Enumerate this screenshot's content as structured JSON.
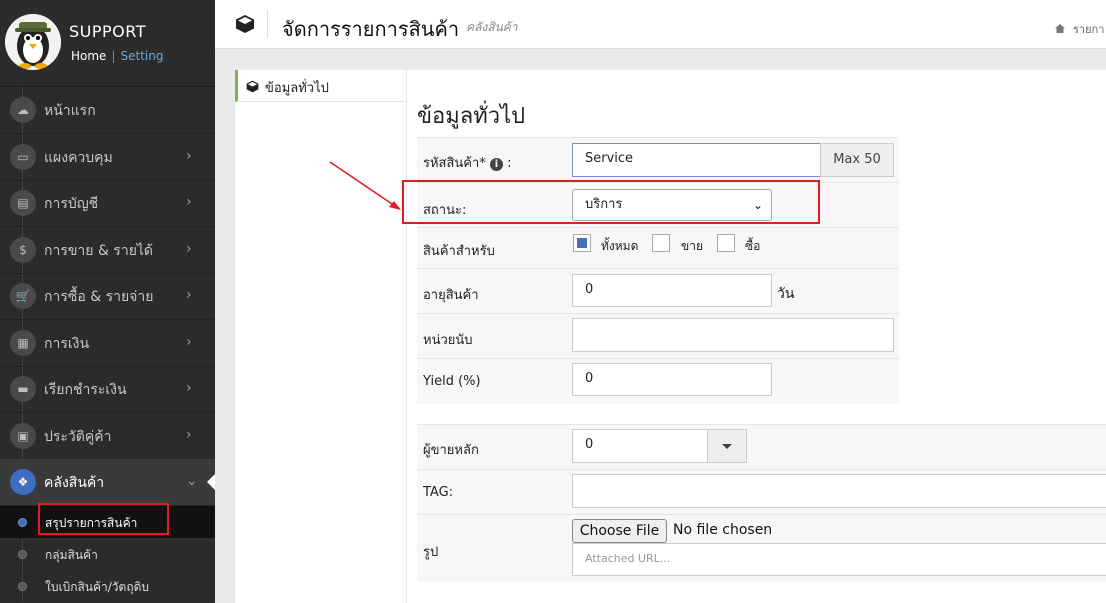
{
  "sidebar": {
    "brand": {
      "title": "SUPPORT",
      "home": "Home",
      "separator": "|",
      "setting": "Setting"
    },
    "items": [
      {
        "label": "หน้าแรก",
        "icon": "cloud-icon",
        "glyph": "☁"
      },
      {
        "label": "แผงควบคุม",
        "icon": "monitor-icon",
        "glyph": "▭"
      },
      {
        "label": "การบัญชี",
        "icon": "book-icon",
        "glyph": "▤"
      },
      {
        "label": "การขาย & รายได้",
        "icon": "dollar-icon",
        "glyph": "$"
      },
      {
        "label": "การซื้อ & รายจ่าย",
        "icon": "cart-icon",
        "glyph": "🛒"
      },
      {
        "label": "การเงิน",
        "icon": "calendar-icon",
        "glyph": "▦"
      },
      {
        "label": "เรียกชำระเงิน",
        "icon": "card-icon",
        "glyph": "▬"
      },
      {
        "label": "ประวัติคู่ค้า",
        "icon": "contact-icon",
        "glyph": "▣"
      },
      {
        "label": "คลังสินค้า",
        "icon": "cubes-icon",
        "glyph": "❖"
      }
    ],
    "chevron": "›",
    "chevron_down": "⌄",
    "subitems": [
      {
        "label": "สรุปรายการสินค้า"
      },
      {
        "label": "กลุ่มสินค้า"
      },
      {
        "label": "ใบเบิกสินค้า/วัตถุดิบ"
      }
    ]
  },
  "header": {
    "title": "จัดการรายการสินค้า",
    "subtitle": "คลังสินค้า",
    "breadcrumb": "รายกา"
  },
  "tabs": {
    "general": "ข้อมูลทั่วไป"
  },
  "form": {
    "section_title": "ข้อมูลทั่วไป",
    "code": {
      "label": "รหัสสินค้า*",
      "suffix": ":",
      "value": "Service",
      "addon": "Max 50"
    },
    "status": {
      "label": "สถานะ:",
      "value": "บริการ"
    },
    "for": {
      "label": "สินค้าสำหรับ",
      "options": [
        "ทั้งหมด",
        "ขาย",
        "ซื้อ"
      ],
      "checked": [
        true,
        false,
        false
      ]
    },
    "age": {
      "label": "อายุสินค้า",
      "value": "0",
      "unit": "วัน"
    },
    "unit": {
      "label": "หน่วยนับ",
      "value": ""
    },
    "yield": {
      "label": "Yield (%)",
      "value": "0"
    },
    "vendor": {
      "label": "ผู้ขายหลัก",
      "value": "0"
    },
    "tag": {
      "label": "TAG:",
      "value": ""
    },
    "image": {
      "label": "รูป",
      "button": "Choose File",
      "file_status": "No file chosen",
      "url_placeholder": "Attached URL..."
    }
  },
  "colors": {
    "sidebar": "#2b2b2b",
    "accent": "#3d6ebf",
    "highlight": "#e01b24",
    "tab_accent": "#7fb351"
  }
}
